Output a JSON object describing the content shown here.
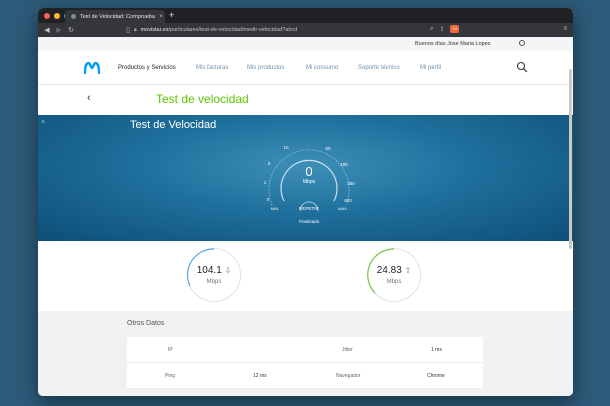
{
  "browser": {
    "tab_title": "Test de Velocidad: Comprueba",
    "tab_close": "×",
    "new_tab": "+",
    "url_host": "movistar.es",
    "url_path": "/particulares/test-de-velocidad/medir-velocidad?abcd",
    "brave_count": "19"
  },
  "greeting": "Buenos días Jose Maria Lopez",
  "nav": {
    "items": [
      {
        "label": "Productos y Servicios",
        "active": true
      },
      {
        "label": "Mis facturas"
      },
      {
        "label": "Mis productos"
      },
      {
        "label": "Mi consumo"
      },
      {
        "label": "Soporte técnico"
      },
      {
        "label": "Mi perfil"
      }
    ]
  },
  "page_title": "Test de velocidad",
  "back": "‹",
  "speedtest": {
    "title": "Test de Velocidad",
    "close": "×",
    "gauge_value": "0",
    "gauge_unit": "Mbps",
    "scale_labels": [
      "0",
      "1",
      "3",
      "10",
      "50",
      "100",
      "300",
      "600"
    ],
    "min_label": "MIN.",
    "max_label": "MAX.",
    "repeat_label": "REPETIR",
    "status": "Finalizado"
  },
  "results": {
    "download": {
      "value": "104.1",
      "unit": "Mbps",
      "arrow": "⇩",
      "color": "#55a7e0"
    },
    "upload": {
      "value": "24.83",
      "unit": "Mbps",
      "arrow": "⇧",
      "color": "#7cc74a"
    }
  },
  "otros": {
    "title": "Otros Datos",
    "rows": [
      {
        "k1": "IP",
        "v1": "",
        "k2": "Jitter",
        "v2": "1 ms"
      },
      {
        "k1": "Ping",
        "v1": "12 ms",
        "k2": "Navegador",
        "v2": "Chrome"
      }
    ]
  },
  "colors": {
    "brand_blue": "#019df4",
    "accent_green": "#5bc500"
  }
}
